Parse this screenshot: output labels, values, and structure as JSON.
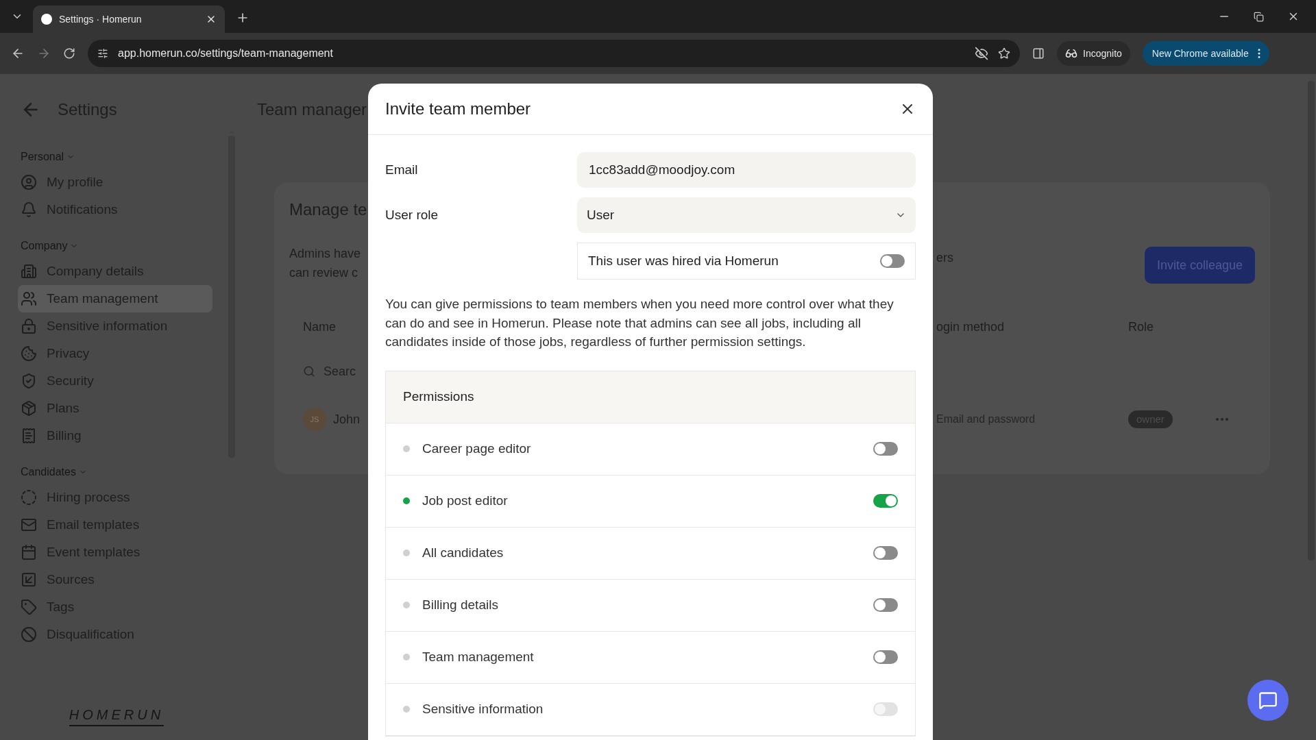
{
  "browser": {
    "tab_title": "Settings · Homerun",
    "url": "app.homerun.co/settings/team-management",
    "incognito": "Incognito",
    "update": "New Chrome available"
  },
  "sidebar": {
    "title": "Settings",
    "sections": [
      {
        "label": "Personal",
        "items": [
          {
            "label": "My profile",
            "selected": false
          },
          {
            "label": "Notifications",
            "selected": false
          }
        ]
      },
      {
        "label": "Company",
        "items": [
          {
            "label": "Company details",
            "selected": false
          },
          {
            "label": "Team management",
            "selected": true
          },
          {
            "label": "Sensitive information",
            "selected": false
          },
          {
            "label": "Privacy",
            "selected": false
          },
          {
            "label": "Security",
            "selected": false
          },
          {
            "label": "Plans",
            "selected": false
          },
          {
            "label": "Billing",
            "selected": false
          }
        ]
      },
      {
        "label": "Candidates",
        "items": [
          {
            "label": "Hiring process",
            "selected": false
          },
          {
            "label": "Email templates",
            "selected": false
          },
          {
            "label": "Event templates",
            "selected": false
          },
          {
            "label": "Sources",
            "selected": false
          },
          {
            "label": "Tags",
            "selected": false
          },
          {
            "label": "Disqualification",
            "selected": false
          }
        ]
      }
    ],
    "logo": "HOMERUN"
  },
  "page": {
    "title": "Team manager",
    "card_title": "Manage te",
    "description_left": [
      "Admins have",
      "can review c"
    ],
    "description_right": "ers",
    "invite_button": "Invite colleague",
    "table": {
      "column_1": "Name",
      "column_2": "ogin method",
      "column_3": "Role",
      "search_placeholder": "Searc",
      "row": {
        "initials": "JS",
        "name": "John",
        "login": "Email and password",
        "role": "owner"
      }
    }
  },
  "modal": {
    "title": "Invite team member",
    "email": {
      "label": "Email",
      "value": "1cc83add@moodjoy.com"
    },
    "role": {
      "label": "User role",
      "value": "User"
    },
    "hired": {
      "label": "This user was hired via Homerun",
      "on": false
    },
    "info": "You can give permissions to team members when you need more control over what they can do and see in Homerun. Please note that admins can see all jobs, including all candidates inside of those jobs, regardless of further permission settings.",
    "permissions": {
      "title": "Permissions",
      "items": [
        {
          "label": "Career page editor",
          "on": false,
          "disabled": false
        },
        {
          "label": "Job post editor",
          "on": true,
          "disabled": false
        },
        {
          "label": "All candidates",
          "on": false,
          "disabled": false
        },
        {
          "label": "Billing details",
          "on": false,
          "disabled": false
        },
        {
          "label": "Team management",
          "on": false,
          "disabled": false
        },
        {
          "label": "Sensitive information",
          "on": false,
          "disabled": true
        }
      ]
    }
  }
}
